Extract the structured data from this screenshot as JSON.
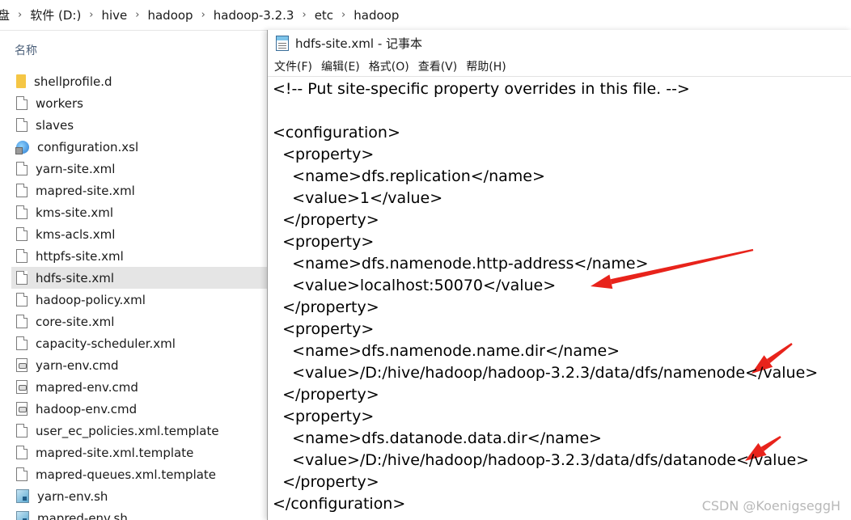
{
  "breadcrumb": {
    "items": [
      "盘",
      "软件 (D:)",
      "hive",
      "hadoop",
      "hadoop-3.2.3",
      "etc",
      "hadoop"
    ]
  },
  "explorer": {
    "column_header": "名称",
    "files": [
      {
        "name": "shellprofile.d",
        "icon": "folder-icon"
      },
      {
        "name": "workers",
        "icon": "file-icon"
      },
      {
        "name": "slaves",
        "icon": "file-icon"
      },
      {
        "name": "configuration.xsl",
        "icon": "xsl-file-icon"
      },
      {
        "name": "yarn-site.xml",
        "icon": "file-icon"
      },
      {
        "name": "mapred-site.xml",
        "icon": "file-icon"
      },
      {
        "name": "kms-site.xml",
        "icon": "file-icon"
      },
      {
        "name": "kms-acls.xml",
        "icon": "file-icon"
      },
      {
        "name": "httpfs-site.xml",
        "icon": "file-icon"
      },
      {
        "name": "hdfs-site.xml",
        "icon": "file-icon",
        "selected": true
      },
      {
        "name": "hadoop-policy.xml",
        "icon": "file-icon"
      },
      {
        "name": "core-site.xml",
        "icon": "file-icon"
      },
      {
        "name": "capacity-scheduler.xml",
        "icon": "file-icon"
      },
      {
        "name": "yarn-env.cmd",
        "icon": "cmd-file-icon"
      },
      {
        "name": "mapred-env.cmd",
        "icon": "cmd-file-icon"
      },
      {
        "name": "hadoop-env.cmd",
        "icon": "cmd-file-icon"
      },
      {
        "name": "user_ec_policies.xml.template",
        "icon": "file-icon"
      },
      {
        "name": "mapred-site.xml.template",
        "icon": "file-icon"
      },
      {
        "name": "mapred-queues.xml.template",
        "icon": "file-icon"
      },
      {
        "name": "yarn-env.sh",
        "icon": "shell-file-icon"
      },
      {
        "name": "mapred-env.sh",
        "icon": "shell-file-icon"
      }
    ]
  },
  "notepad": {
    "title": "hdfs-site.xml - 记事本",
    "menu": [
      "文件(F)",
      "编辑(E)",
      "格式(O)",
      "查看(V)",
      "帮助(H)"
    ],
    "lines": [
      "<!-- Put site-specific property overrides in this file. -->",
      "",
      "<configuration>",
      "  <property>",
      "    <name>dfs.replication</name>",
      "    <value>1</value>",
      "  </property>",
      "  <property>",
      "    <name>dfs.namenode.http-address</name>",
      "    <value>localhost:50070</value>",
      "  </property>",
      "  <property>",
      "    <name>dfs.namenode.name.dir</name>",
      "    <value>/D:/hive/hadoop/hadoop-3.2.3/data/dfs/namenode</value>",
      "  </property>",
      "  <property>",
      "    <name>dfs.datanode.data.dir</name>",
      "    <value>/D:/hive/hadoop/hadoop-3.2.3/data/dfs/datanode</value>",
      "  </property>",
      "</configuration>"
    ]
  },
  "annotation_color": "#e8231b",
  "watermark": "CSDN @KoenigseggH"
}
